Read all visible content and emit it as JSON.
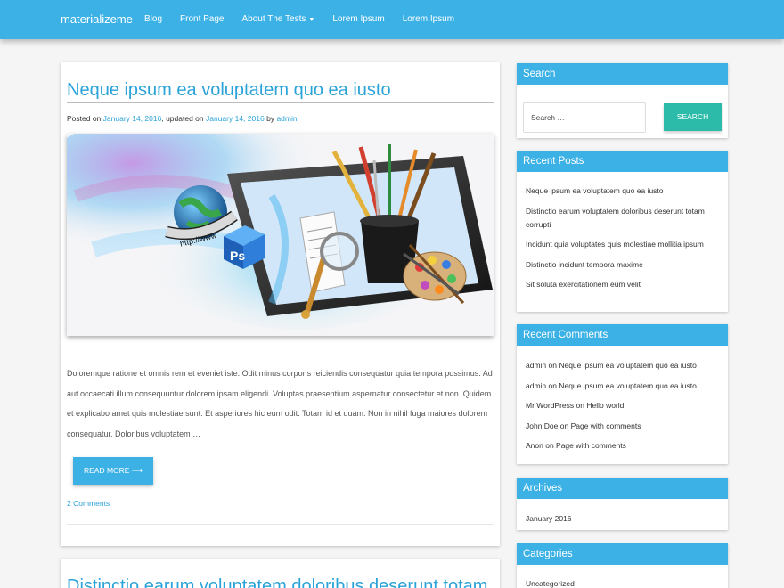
{
  "nav": {
    "brand": "materializeme",
    "items": [
      "Blog",
      "Front Page",
      "About The Tests",
      "Lorem Ipsum",
      "Lorem Ipsum"
    ],
    "dropdown_caret": "▼"
  },
  "post": {
    "title": "Neque ipsum ea voluptatem quo ea iusto",
    "meta_posted": "Posted on",
    "meta_date1": "January 14, 2016",
    "meta_updated": ", updated on",
    "meta_date2": "January 14, 2016",
    "meta_by": "by",
    "meta_author": "admin",
    "image_text": "http://www",
    "image_badge": "Ps",
    "excerpt": "Doloremque ratione et omnis rem et eveniet iste. Odit minus corporis reiciendis consequatur quia tempora possimus. Ad aut occaecati illum consequuntur dolorem ipsam eligendi. Voluptas praesentium aspernatur consectetur et non. Quidem et explicabo amet quis molestiae sunt. Et asperiores hic eum odit. Totam id et quam. Non in nihil fuga maiores dolorem consequatur. Doloribus voluptatem …",
    "read_more": "READ MORE ⟶",
    "comments_link": "2 Comments"
  },
  "post2": {
    "title": "Distinctio earum voluptatem doloribus deserunt totam"
  },
  "sidebar": {
    "search": {
      "title": "Search",
      "placeholder": "Search …",
      "button": "SEARCH"
    },
    "recent_posts": {
      "title": "Recent Posts",
      "items": [
        "Neque ipsum ea voluptatem quo ea iusto",
        "Distinctio earum voluptatem doloribus deserunt totam corrupti",
        "Incidunt quia voluptates quis molestiae mollitia ipsum",
        "Distinctio incidunt tempora maxime",
        "Sit soluta exercitationem eum velit"
      ]
    },
    "recent_comments": {
      "title": "Recent Comments",
      "items": [
        "admin on Neque ipsum ea voluptatem quo ea iusto",
        "admin on Neque ipsum ea voluptatem quo ea iusto",
        "Mr WordPress on Hello world!",
        "John Doe on Page with comments",
        "Anon on Page with comments"
      ]
    },
    "archives": {
      "title": "Archives",
      "items": [
        "January 2016"
      ]
    },
    "categories": {
      "title": "Categories",
      "items": [
        "Uncategorized"
      ]
    }
  },
  "colors": {
    "primary": "#3cb1e6",
    "search_button": "#2bbba8",
    "link": "#2aa3d8"
  }
}
